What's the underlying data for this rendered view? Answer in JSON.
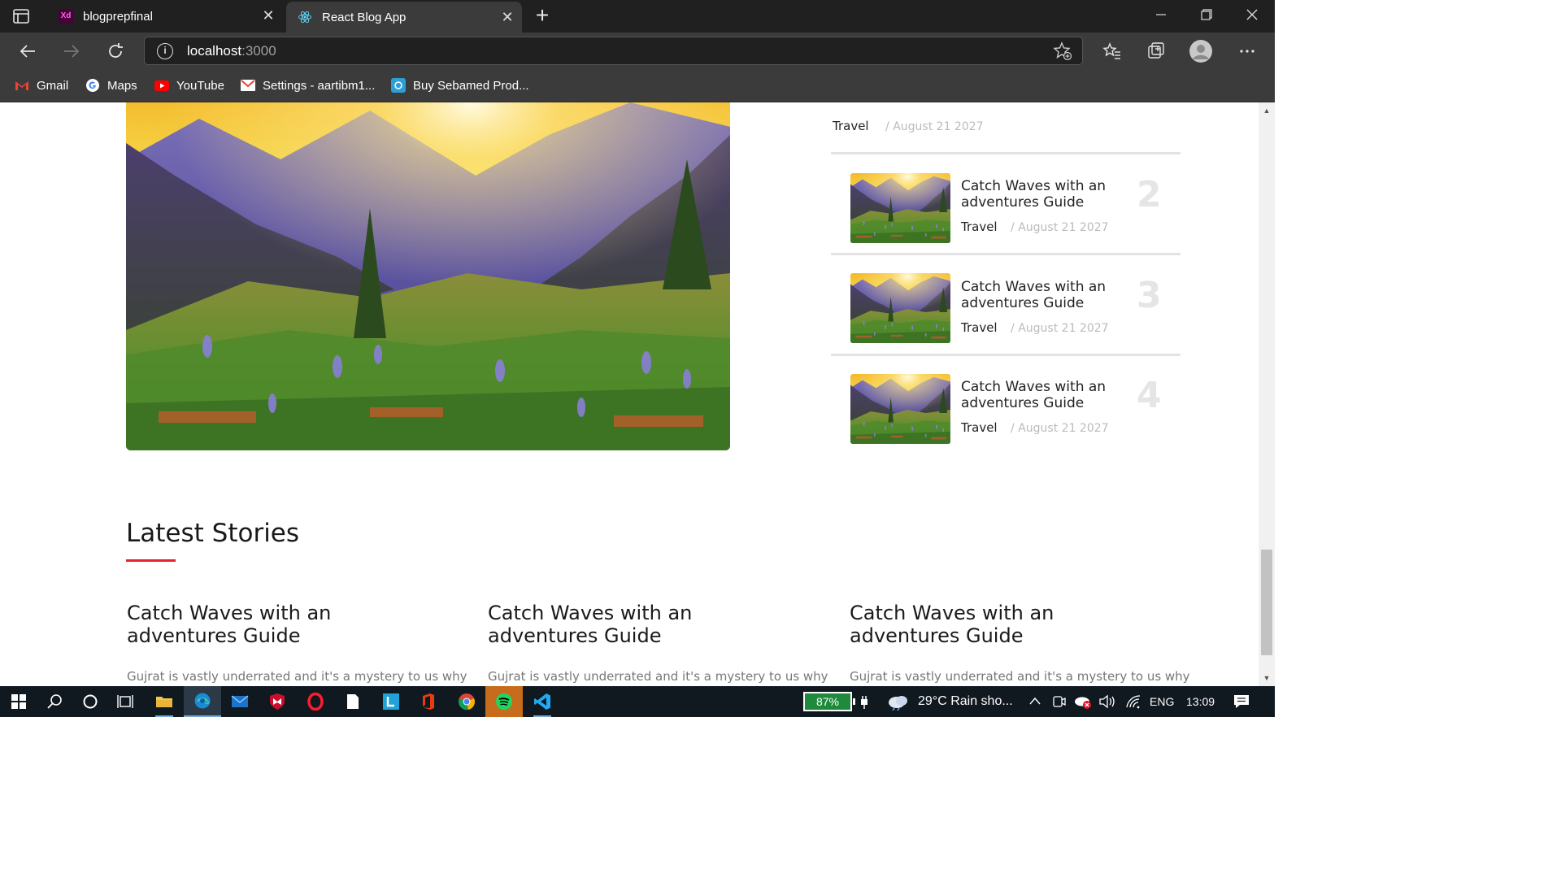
{
  "browser": {
    "tabs": [
      {
        "label": "blogprepfinal",
        "icon": "xd-icon",
        "active": false
      },
      {
        "label": "React Blog App",
        "icon": "react-icon",
        "active": true
      }
    ],
    "address": {
      "host": "localhost",
      "port": ":3000"
    },
    "bookmarks": [
      {
        "label": "Gmail",
        "icon": "gmail-icon"
      },
      {
        "label": "Maps",
        "icon": "google-icon"
      },
      {
        "label": "YouTube",
        "icon": "youtube-icon"
      },
      {
        "label": "Settings - aartibm1...",
        "icon": "gmail-icon"
      },
      {
        "label": "Buy Sebamed Prod...",
        "icon": "sebamed-icon"
      }
    ]
  },
  "sidebar": {
    "partial_item": {
      "category": "Travel",
      "date": "/ August 21 2027"
    },
    "items": [
      {
        "title": "Catch Waves with an adventures Guide",
        "category": "Travel",
        "date": "/ August 21 2027",
        "number": "2"
      },
      {
        "title": "Catch Waves with an adventures Guide",
        "category": "Travel",
        "date": "/ August 21 2027",
        "number": "3"
      },
      {
        "title": "Catch Waves with an adventures Guide",
        "category": "Travel",
        "date": "/ August 21 2027",
        "number": "4"
      }
    ]
  },
  "latest": {
    "title": "Latest Stories",
    "stories": [
      {
        "title": "Catch Waves with an adventures Guide",
        "excerpt": "Gujrat is vastly underrated and it's a mystery to us why"
      },
      {
        "title": "Catch Waves with an adventures Guide",
        "excerpt": "Gujrat is vastly underrated and it's a mystery to us why"
      },
      {
        "title": "Catch Waves with an adventures Guide",
        "excerpt": "Gujrat is vastly underrated and it's a mystery to us why"
      }
    ]
  },
  "taskbar": {
    "battery": "87%",
    "weather": "29°C  Rain sho...",
    "language": "ENG",
    "time": "13:09"
  },
  "colors": {
    "accent_underline": "#e3242b",
    "chrome_dark": "#202020",
    "chrome_mid": "#3b3b3b",
    "taskbar": "#101820"
  }
}
